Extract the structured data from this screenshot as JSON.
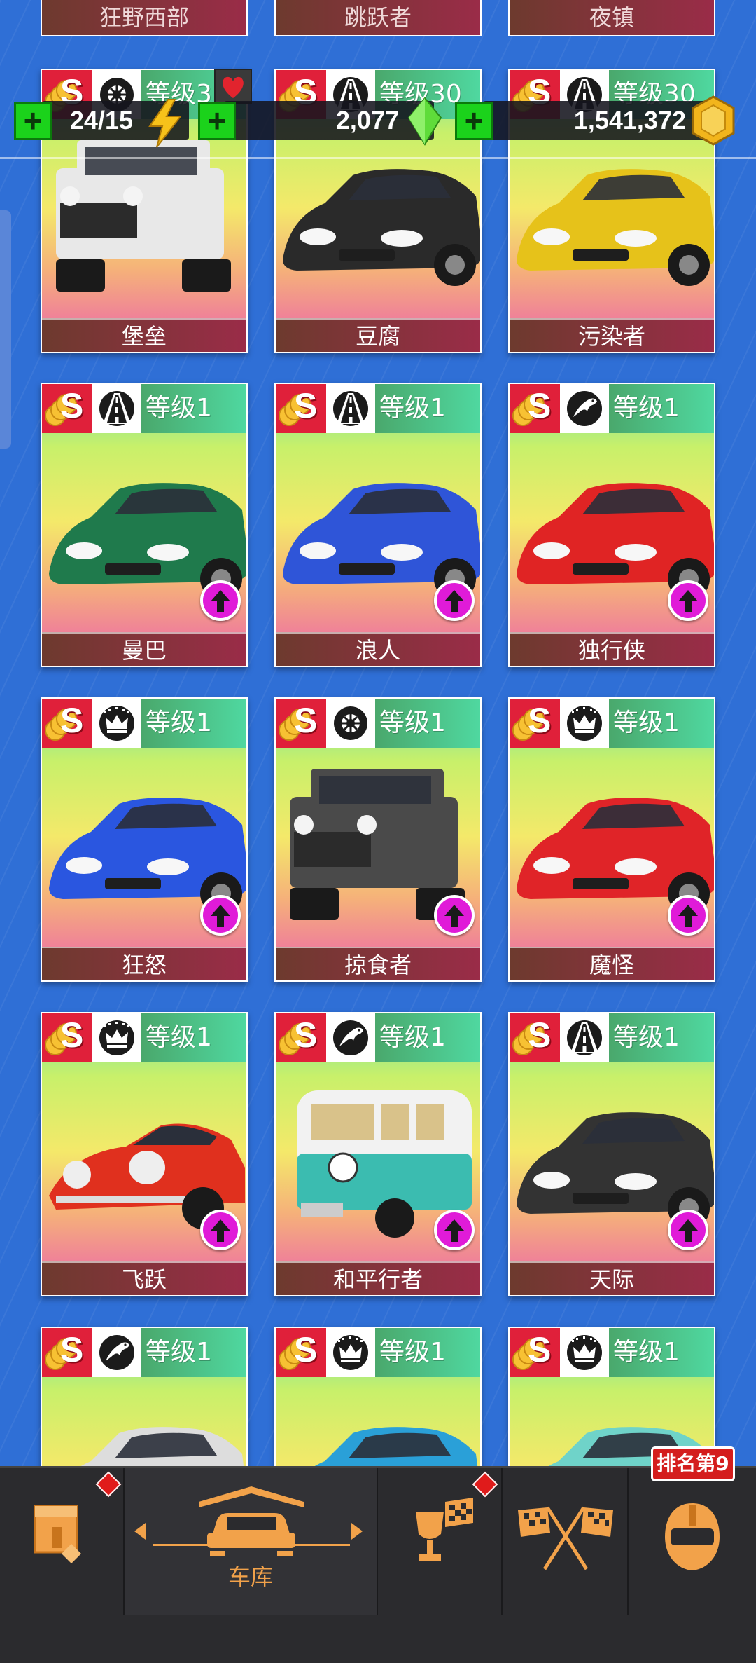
{
  "top_row_names": [
    "狂野西部",
    "跳跃者",
    "夜镇"
  ],
  "resources": {
    "energy": "24/15",
    "gems": "2,077",
    "coins": "1,541,372",
    "plus_label": "+"
  },
  "cards": [
    {
      "name": "堡垒",
      "level": "等级3",
      "type_icon": "tire-icon",
      "car_color": "#e8e8e8",
      "car_style": "suv",
      "upgrade": false
    },
    {
      "name": "豆腐",
      "level": "等级30",
      "type_icon": "road-icon",
      "car_color": "#2a2a2a",
      "car_style": "coupe",
      "upgrade": false
    },
    {
      "name": "污染者",
      "level": "等级30",
      "type_icon": "road-icon",
      "car_color": "#e6c21a",
      "car_style": "hatch",
      "upgrade": false
    },
    {
      "name": "曼巴",
      "level": "等级1",
      "type_icon": "road-icon",
      "car_color": "#1f7a4c",
      "car_style": "coupe",
      "upgrade": true
    },
    {
      "name": "浪人",
      "level": "等级1",
      "type_icon": "road-icon",
      "car_color": "#2f55d8",
      "car_style": "sports",
      "upgrade": true
    },
    {
      "name": "独行侠",
      "level": "等级1",
      "type_icon": "horse-icon",
      "car_color": "#e02424",
      "car_style": "muscle",
      "upgrade": true
    },
    {
      "name": "狂怒",
      "level": "等级1",
      "type_icon": "crown-icon",
      "car_color": "#2a56e0",
      "car_style": "super",
      "upgrade": true
    },
    {
      "name": "掠食者",
      "level": "等级1",
      "type_icon": "tire-icon",
      "car_color": "#4a4a4a",
      "car_style": "truck",
      "upgrade": true
    },
    {
      "name": "魔怪",
      "level": "等级1",
      "type_icon": "crown-icon",
      "car_color": "#e02428",
      "car_style": "super",
      "upgrade": true
    },
    {
      "name": "飞跃",
      "level": "等级1",
      "type_icon": "crown-icon",
      "car_color": "#e0301e",
      "car_style": "classic",
      "upgrade": true
    },
    {
      "name": "和平行者",
      "level": "等级1",
      "type_icon": "horse-icon",
      "car_color": "#3bbcb0",
      "car_style": "van",
      "upgrade": true
    },
    {
      "name": "天际",
      "level": "等级1",
      "type_icon": "road-icon",
      "car_color": "#333333",
      "car_style": "coupe",
      "upgrade": true
    },
    {
      "name": "",
      "level": "等级1",
      "type_icon": "horse-icon",
      "car_color": "#dddddd",
      "car_style": "coupe",
      "upgrade": false
    },
    {
      "name": "",
      "level": "等级1",
      "type_icon": "crown-icon",
      "car_color": "#2aa0d8",
      "car_style": "sports",
      "upgrade": false
    },
    {
      "name": "",
      "level": "等级1",
      "type_icon": "crown-icon",
      "car_color": "#6fd3c9",
      "car_style": "sports",
      "upgrade": false
    }
  ],
  "nav": {
    "garage_label": "车库",
    "rank_badge": "排名第9",
    "items": [
      "shop-icon",
      "garage-car-icon",
      "trophy-flag-icon",
      "race-flags-icon",
      "helmet-icon"
    ]
  },
  "colors": {
    "background": "#2f6fd6",
    "accent_orange": "#f2a24a",
    "plus_green": "#1bd21b",
    "upgrade_magenta": "#e01bd8"
  }
}
